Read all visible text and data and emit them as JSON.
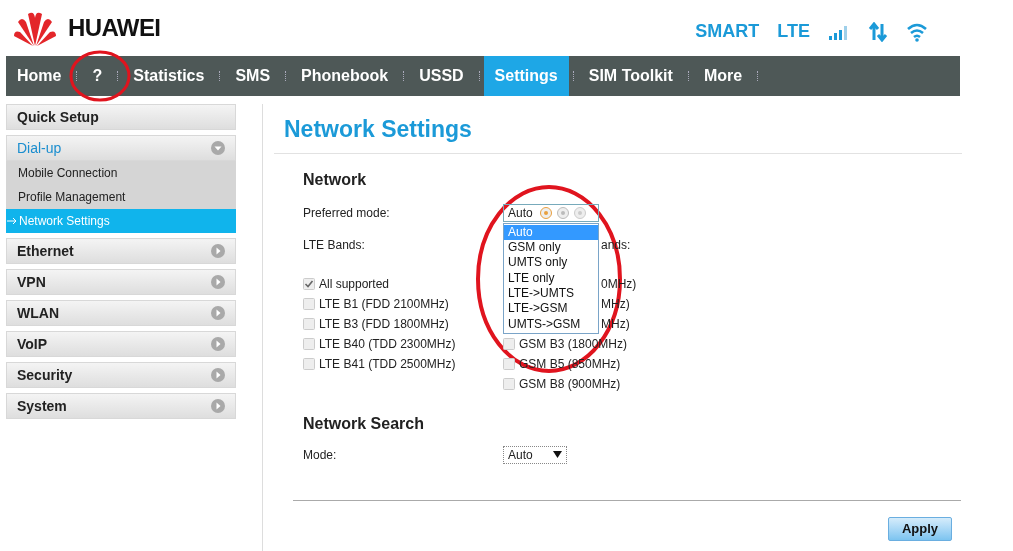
{
  "header": {
    "logo": "HUAWEI",
    "status": [
      "SMART",
      "LTE"
    ]
  },
  "nav": [
    {
      "label": "Home",
      "selected": false
    },
    {
      "label": "?",
      "selected": false
    },
    {
      "label": "Statistics",
      "selected": false
    },
    {
      "label": "SMS",
      "selected": false
    },
    {
      "label": "Phonebook",
      "selected": false
    },
    {
      "label": "USSD",
      "selected": false
    },
    {
      "label": "Settings",
      "selected": true
    },
    {
      "label": "SIM Toolkit",
      "selected": false
    },
    {
      "label": "More",
      "selected": false
    }
  ],
  "sidebar": [
    {
      "label": "Quick Setup",
      "kind": "plain"
    },
    {
      "label": "Dial-up",
      "kind": "group",
      "expanded": true,
      "children": [
        {
          "label": "Mobile Connection",
          "selected": false
        },
        {
          "label": "Profile Management",
          "selected": false
        },
        {
          "label": "Network Settings",
          "selected": true
        }
      ]
    },
    {
      "label": "Ethernet",
      "kind": "group",
      "expanded": false
    },
    {
      "label": "VPN",
      "kind": "group",
      "expanded": false
    },
    {
      "label": "WLAN",
      "kind": "group",
      "expanded": false
    },
    {
      "label": "VoIP",
      "kind": "group",
      "expanded": false
    },
    {
      "label": "Security",
      "kind": "group",
      "expanded": false
    },
    {
      "label": "System",
      "kind": "group",
      "expanded": false
    }
  ],
  "content": {
    "title": "Network Settings",
    "network": {
      "heading": "Network",
      "preferred_mode_label": "Preferred mode:",
      "preferred_mode_value": "Auto",
      "options": [
        {
          "label": "Auto",
          "selected": true
        },
        {
          "label": "GSM only",
          "selected": false
        },
        {
          "label": "UMTS only",
          "selected": false
        },
        {
          "label": "LTE only",
          "selected": false
        },
        {
          "label": "LTE->UMTS",
          "selected": false
        },
        {
          "label": "LTE->GSM",
          "selected": false
        },
        {
          "label": "UMTS->GSM",
          "selected": false
        }
      ],
      "lte_bands_label": "LTE Bands:",
      "gsm_bands_label": "ands:",
      "lte_bands": [
        {
          "label": "All supported",
          "checked": true
        },
        {
          "label": "LTE B1 (FDD 2100MHz)",
          "checked": false
        },
        {
          "label": "LTE B3 (FDD 1800MHz)",
          "checked": false
        },
        {
          "label": "LTE B40 (TDD 2300MHz)",
          "checked": false
        },
        {
          "label": "LTE B41 (TDD 2500MHz)",
          "checked": false
        }
      ],
      "gsm_bands": [
        {
          "label": "0MHz)",
          "kind": "covered"
        },
        {
          "label": "MHz)",
          "kind": "covered"
        },
        {
          "label": "MHz)",
          "kind": "covered"
        },
        {
          "label": "GSM B3 (1800MHz)",
          "kind": "checkbox",
          "checked": false
        },
        {
          "label": "GSM B5 (850MHz)",
          "kind": "checkbox",
          "checked": false
        },
        {
          "label": "GSM B8 (900MHz)",
          "kind": "checkbox",
          "checked": false
        }
      ]
    },
    "network_search": {
      "heading": "Network Search",
      "mode_label": "Mode:",
      "mode_value": "Auto"
    },
    "apply": "Apply"
  }
}
